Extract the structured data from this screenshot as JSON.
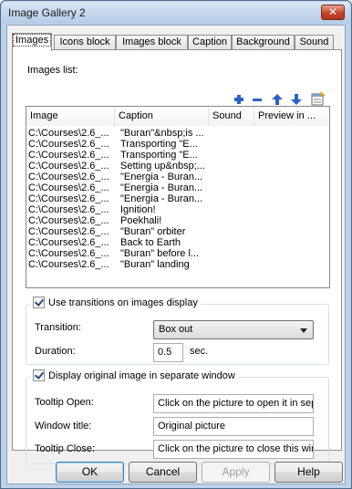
{
  "window": {
    "title": "Image Gallery 2"
  },
  "tabs": [
    {
      "label": "Images"
    },
    {
      "label": "Icons block"
    },
    {
      "label": "Images block"
    },
    {
      "label": "Caption"
    },
    {
      "label": "Background"
    },
    {
      "label": "Sound"
    }
  ],
  "images_list": {
    "label": "Images list:",
    "toolbar": [
      "add-icon",
      "remove-icon",
      "move-up-icon",
      "move-down-icon",
      "properties-icon"
    ],
    "columns": [
      "Image",
      "Caption",
      "Sound",
      "Preview in ..."
    ],
    "rows": [
      {
        "image": "C:\\Courses\\2.6_...",
        "caption": "\"Buran\"&nbsp;is ..."
      },
      {
        "image": "C:\\Courses\\2.6_...",
        "caption": "Transporting \"E..."
      },
      {
        "image": "C:\\Courses\\2.6_...",
        "caption": "Transporting \"E..."
      },
      {
        "image": "C:\\Courses\\2.6_...",
        "caption": "Setting up&nbsp;..."
      },
      {
        "image": "C:\\Courses\\2.6_...",
        "caption": "\"Energia - Buran..."
      },
      {
        "image": "C:\\Courses\\2.6_...",
        "caption": "\"Energia - Buran..."
      },
      {
        "image": "C:\\Courses\\2.6_...",
        "caption": "\"Energia - Buran..."
      },
      {
        "image": "C:\\Courses\\2.6_...",
        "caption": "Ignition!"
      },
      {
        "image": "C:\\Courses\\2.6_...",
        "caption": "Poekhali!"
      },
      {
        "image": "C:\\Courses\\2.6_...",
        "caption": "\"Buran\" orbiter"
      },
      {
        "image": "C:\\Courses\\2.6_...",
        "caption": "Back to Earth"
      },
      {
        "image": "C:\\Courses\\2.6_...",
        "caption": "\"Buran\" before l..."
      },
      {
        "image": "C:\\Courses\\2.6_...",
        "caption": "\"Buran\" landing"
      }
    ]
  },
  "transitions": {
    "checkbox_label": "Use transitions on images display",
    "checked": true,
    "transition_label": "Transition:",
    "transition_value": "Box out",
    "duration_label": "Duration:",
    "duration_value": "0.5",
    "duration_unit": "sec."
  },
  "original_window": {
    "checkbox_label": "Display original image in separate window",
    "checked": true,
    "tooltip_open_label": "Tooltip Open:",
    "tooltip_open_value": "Click on the picture to open it in sepa",
    "window_title_label": "Window title:",
    "window_title_value": "Original picture",
    "tooltip_close_label": "Tooltip Close:",
    "tooltip_close_value": "Click on the picture to close this wind"
  },
  "buttons": {
    "ok": "OK",
    "cancel": "Cancel",
    "apply": "Apply",
    "help": "Help"
  }
}
